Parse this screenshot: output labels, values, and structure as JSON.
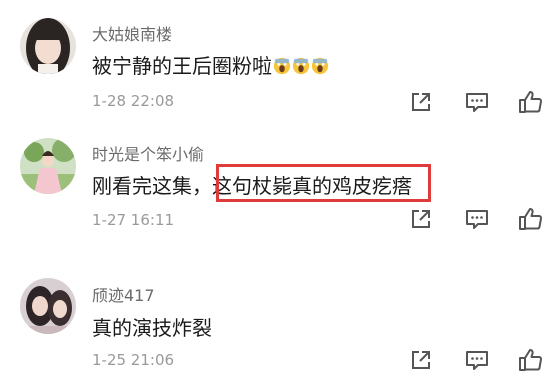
{
  "comments": [
    {
      "username": "大姑娘南楼",
      "text": "被宁静的王后圈粉啦",
      "emojis": [
        "scream-face-icon",
        "scream-face-icon",
        "scream-face-icon"
      ],
      "timestamp": "1-28 22:08",
      "avatar": "avatar-icon"
    },
    {
      "username": "时光是个笨小偷",
      "text": "刚看完这集，",
      "text_highlighted": "这句杖毙真的鸡皮疙瘩",
      "highlight_color": "#e03b3b",
      "timestamp": "1-27 16:11",
      "avatar": "avatar-icon"
    },
    {
      "username": "颀迹417",
      "text": "真的演技炸裂",
      "timestamp": "1-25 21:06",
      "avatar": "avatar-icon"
    }
  ],
  "actions": [
    "share-icon",
    "reply-icon",
    "like-icon"
  ]
}
